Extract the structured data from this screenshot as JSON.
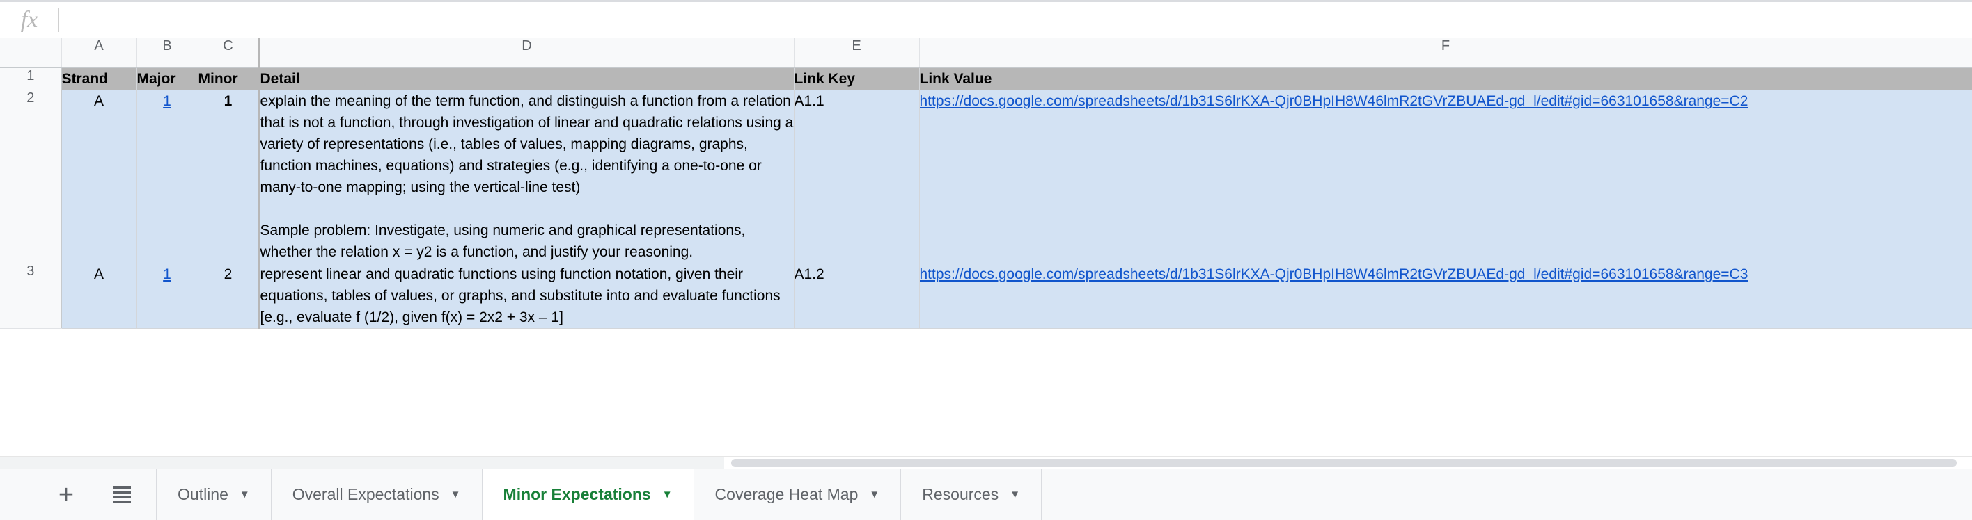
{
  "formula_bar": {
    "fx_icon": "function-icon",
    "value": "",
    "placeholder": ""
  },
  "grid": {
    "column_headers": [
      "",
      "A",
      "B",
      "C",
      "D",
      "E",
      "F"
    ],
    "row_numbers": [
      "1",
      "2",
      "3"
    ],
    "header_row": {
      "A": "Strand",
      "B": "Major",
      "C": "Minor",
      "D": "Detail",
      "E": "Link Key",
      "F": "Link Value"
    },
    "rows": [
      {
        "row": "2",
        "strand": "A",
        "major": "1",
        "minor": "1",
        "detail": "explain the meaning of the term function, and distinguish a function from a relation that is not a function, through investigation of linear and quadratic relations using a variety of representations (i.e., tables of values, mapping diagrams, graphs, function machines, equations) and strategies (e.g., identifying a one-to-one or many-to-one mapping; using the vertical-line test)\n\nSample problem: Investigate, using numeric and graphical representations, whether the relation x = y2 is a function, and justify your reasoning.",
        "link_key": "A1.1",
        "link_value": "https://docs.google.com/spreadsheets/d/1b31S6lrKXA-Qjr0BHpIH8W46lmR2tGVrZBUAEd-gd_l/edit#gid=663101658&range=C2"
      },
      {
        "row": "3",
        "strand": "A",
        "major": "1",
        "minor": "2",
        "detail": "represent linear and quadratic functions using function notation, given their equations, tables of values, or graphs, and substitute into and evaluate functions [e.g., evaluate f (1/2), given f(x) = 2x2 + 3x – 1]",
        "link_key": "A1.2",
        "link_value": "https://docs.google.com/spreadsheets/d/1b31S6lrKXA-Qjr0BHpIH8W46lmR2tGVrZBUAEd-gd_l/edit#gid=663101658&range=C3"
      }
    ]
  },
  "sheet_tabs": {
    "add_sheet_label": "+",
    "all_sheets_icon": "all-sheets-icon",
    "tabs": [
      {
        "label": "Outline",
        "active": false
      },
      {
        "label": "Overall Expectations",
        "active": false
      },
      {
        "label": "Minor Expectations",
        "active": true
      },
      {
        "label": "Coverage Heat Map",
        "active": false
      },
      {
        "label": "Resources",
        "active": false
      }
    ],
    "caret": "▼"
  },
  "colors": {
    "selection_fill": "#d3e2f3",
    "header_fill": "#b7b7b7",
    "link": "#1155cc",
    "active_tab_text": "#188038"
  }
}
